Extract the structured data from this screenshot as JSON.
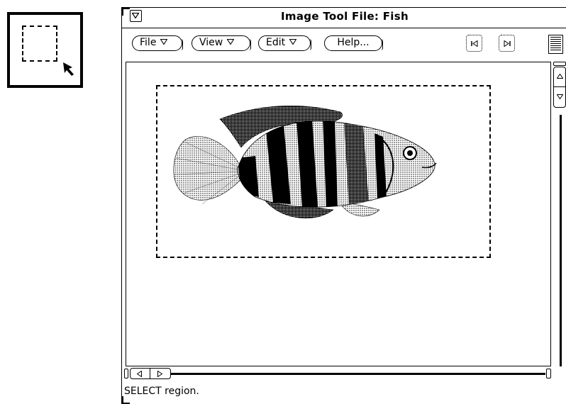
{
  "window": {
    "title": "Image Tool File: Fish"
  },
  "controls": {
    "file_label": "File",
    "view_label": "View",
    "edit_label": "Edit",
    "help_label": "Help..."
  },
  "icons": {
    "tool": "select-region-icon",
    "window_menu": "window-menu-triangle-icon",
    "prev_page": "previous-page-icon",
    "next_page": "next-page-icon",
    "page_view": "page-overview-icon"
  },
  "canvas": {
    "image": "fish-illustration"
  },
  "status": {
    "message": "SELECT region."
  }
}
